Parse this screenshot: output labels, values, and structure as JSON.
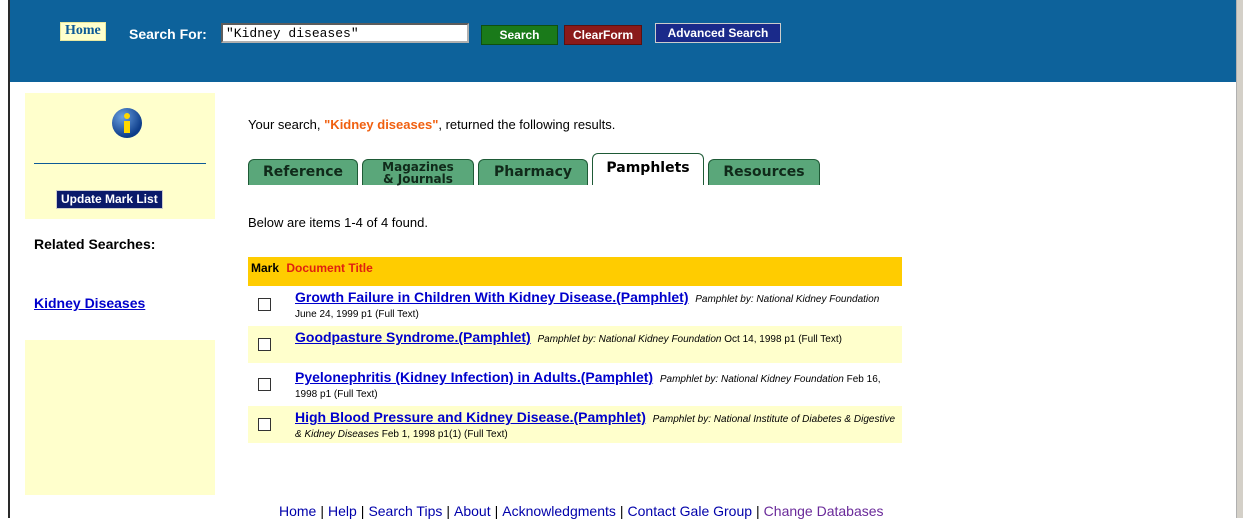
{
  "header": {
    "home_label": "Home",
    "search_label": "Search For:",
    "search_value": "\"Kidney diseases\"",
    "search_button": "Search",
    "clear_button": "ClearForm",
    "advanced_button": "Advanced Search"
  },
  "sidebar": {
    "icon": "info-icon",
    "update_button": "Update Mark List",
    "related_heading": "Related Searches:",
    "related_link": "Kidney Diseases"
  },
  "main": {
    "search_prefix": "Your search,",
    "search_term": "\"Kidney diseases\"",
    "search_suffix": ", returned the following results.",
    "tabs": [
      {
        "label": "Reference",
        "active": false
      },
      {
        "label_line1": "Magazines",
        "label_line2": "& Journals",
        "active": false
      },
      {
        "label": "Pharmacy",
        "active": false
      },
      {
        "label": "Pamphlets",
        "active": true
      },
      {
        "label": "Resources",
        "active": false
      }
    ],
    "found_text": "Below are items 1-4 of 4 found.",
    "col_mark": "Mark",
    "col_title": "Document Title",
    "results": [
      {
        "title": "Growth Failure in Children With Kidney Disease.(Pamphlet)",
        "by": "Pamphlet by: National Kidney Foundation",
        "meta": "June 24, 1999 p1  (Full Text)"
      },
      {
        "title": "Goodpasture Syndrome.(Pamphlet)",
        "by": "Pamphlet by: National Kidney Foundation",
        "meta": "Oct 14, 1998 p1  (Full Text)"
      },
      {
        "title": "Pyelonephritis (Kidney Infection) in Adults.(Pamphlet)",
        "by": "Pamphlet by: National Kidney Foundation",
        "meta": "Feb 16, 1998 p1  (Full Text)"
      },
      {
        "title": "High Blood Pressure and Kidney Disease.(Pamphlet)",
        "by": "Pamphlet by: National Institute of Diabetes & Digestive & Kidney Diseases",
        "meta": "Feb 1, 1998 p1(1)  (Full Text)"
      }
    ]
  },
  "footer": {
    "links": [
      "Home",
      "Help",
      "Search Tips",
      "About",
      "Acknowledgments",
      "Contact Gale Group",
      "Change Databases"
    ]
  },
  "colors": {
    "header_bg": "#0d629b",
    "sidebar_bg": "#ffffcc",
    "results_header_bg": "#ffcc00",
    "tab_bg": "#5aa77a",
    "link": "#0000cc"
  }
}
